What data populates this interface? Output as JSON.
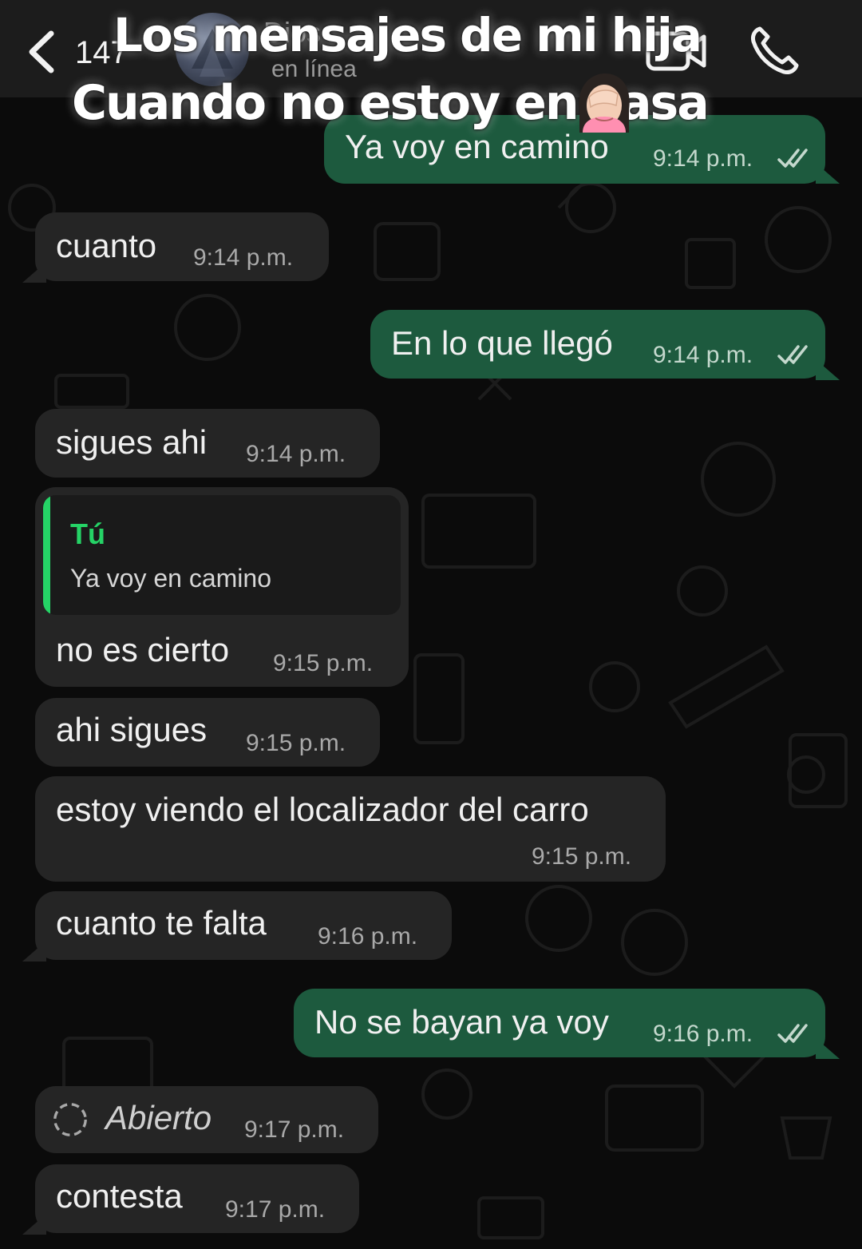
{
  "header": {
    "back_count": "147",
    "contact_name": "Dios",
    "status": "en línea"
  },
  "caption": {
    "line1": "Los mensajes de mi hija",
    "line2": "Cuando no estoy en casa"
  },
  "colors": {
    "incoming_bubble": "#252525",
    "outgoing_bubble": "#1d5a3e",
    "accent": "#25d366",
    "background": "#0b0b0b"
  },
  "messages": [
    {
      "dir": "out",
      "text": "Ya voy en camino",
      "time": "9:14 p.m."
    },
    {
      "dir": "in",
      "text": "cuanto",
      "time": "9:14 p.m."
    },
    {
      "dir": "out",
      "text": "En lo que llegó",
      "time": "9:14 p.m."
    },
    {
      "dir": "in",
      "text": "sigues ahi",
      "time": "9:14 p.m."
    },
    {
      "dir": "in",
      "reply_author": "Tú",
      "reply_text": "Ya voy en camino",
      "text": "no es cierto",
      "time": "9:15 p.m."
    },
    {
      "dir": "in",
      "text": "ahi sigues",
      "time": "9:15 p.m."
    },
    {
      "dir": "in",
      "text": "estoy viendo el localizador del carro",
      "time": "9:15 p.m."
    },
    {
      "dir": "in",
      "text": "cuanto te falta",
      "time": "9:16 p.m."
    },
    {
      "dir": "out",
      "text": "No se bayan ya voy",
      "time": "9:16 p.m."
    },
    {
      "dir": "in",
      "text": "Abierto",
      "time": "9:17 p.m."
    },
    {
      "dir": "in",
      "text": "contesta",
      "time": "9:17 p.m."
    }
  ]
}
